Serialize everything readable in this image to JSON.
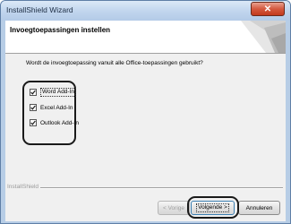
{
  "window": {
    "title": "InstallShield Wizard",
    "close_glyph": "✕"
  },
  "header": {
    "title": "Invoegtoepassingen instellen"
  },
  "question": "Wordt de invoegtoepassing vanuit alle Office-toepassingen gebruikt?",
  "options": [
    {
      "label": "Word Add-In",
      "checked": true
    },
    {
      "label": "Excel Add-In",
      "checked": true
    },
    {
      "label": "Outlook Add-In",
      "checked": true
    }
  ],
  "footer": {
    "brand": "InstallShield"
  },
  "buttons": {
    "back": "< Vorige",
    "next": "Volgende >",
    "cancel": "Annuleren"
  }
}
